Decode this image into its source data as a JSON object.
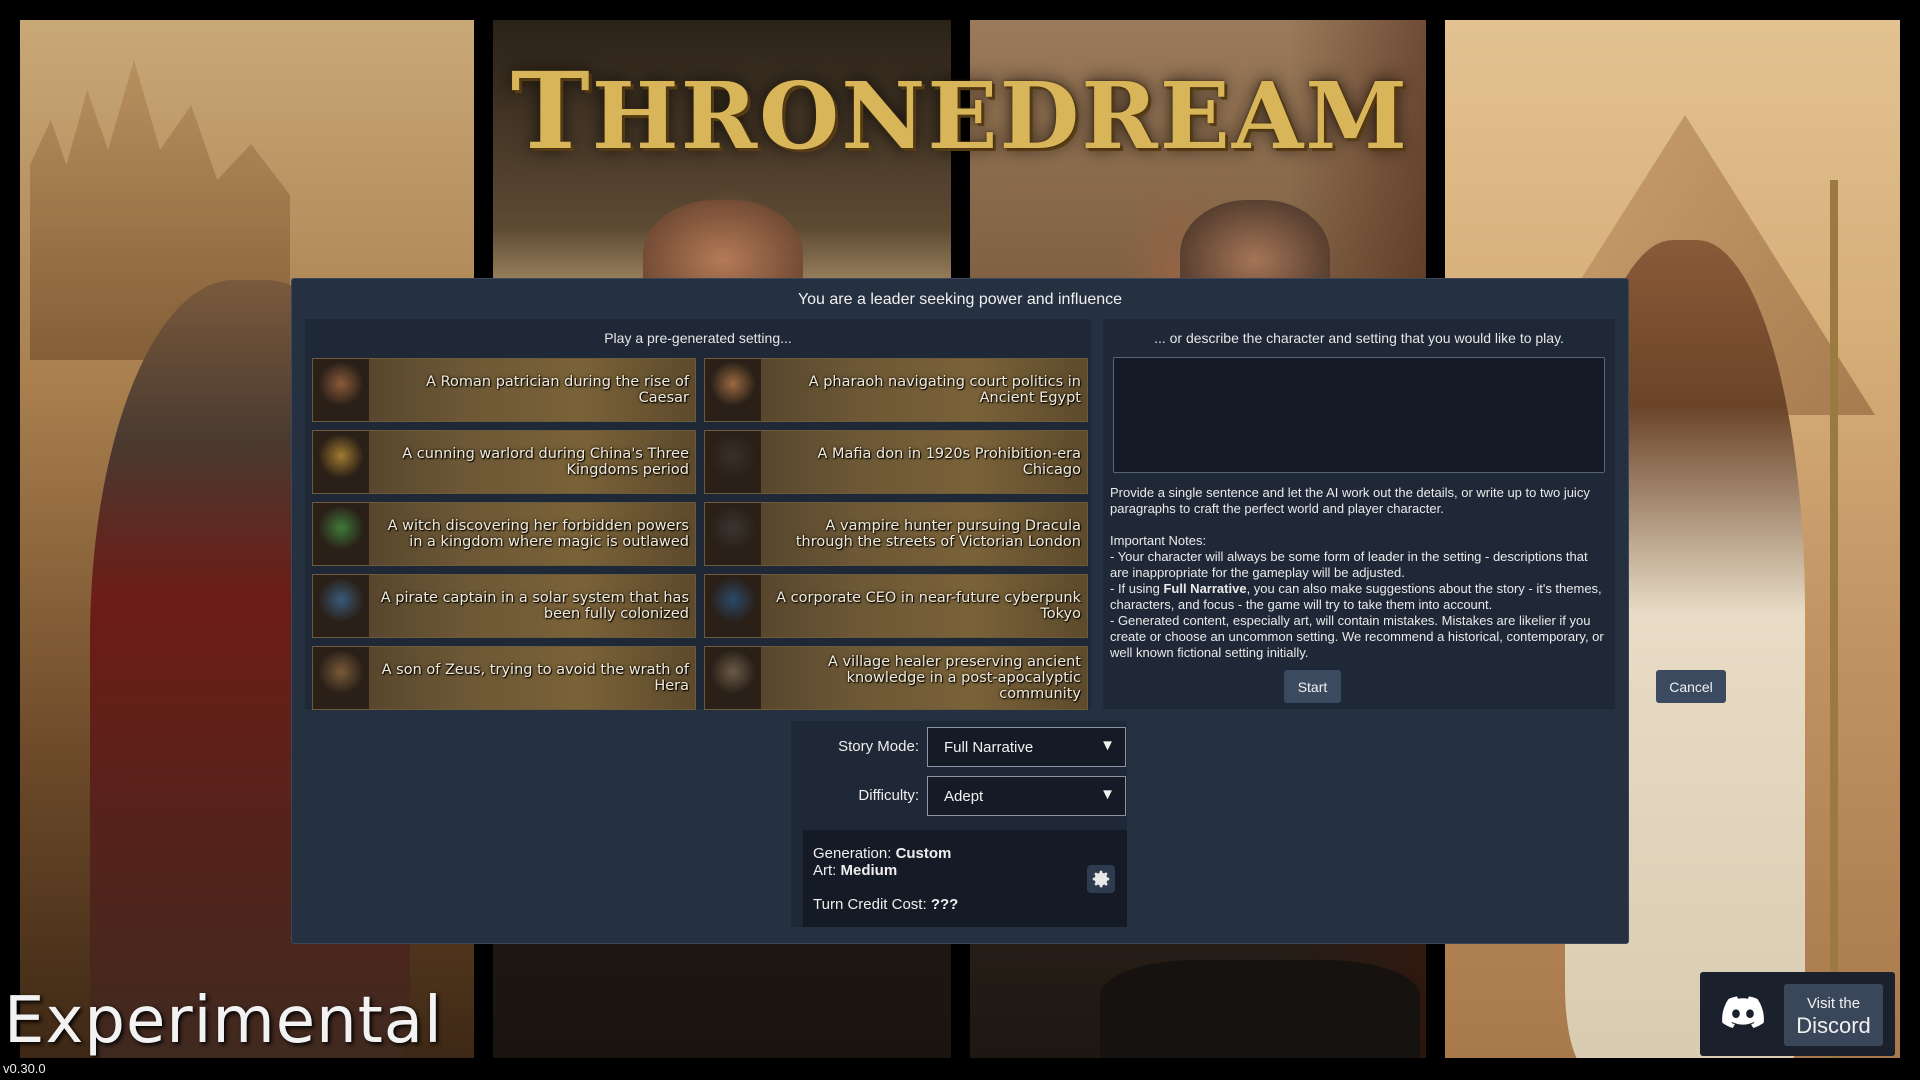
{
  "app": {
    "title": "Thronedream",
    "title_first_letter": "T",
    "title_rest": "HRONEDREAM",
    "experimental_label": "Experimental",
    "version": "v0.30.0"
  },
  "dialog": {
    "heading": "You are a leader seeking power and influence",
    "pregenerated_heading": "Play a pre-generated setting...",
    "settings": [
      {
        "label": "A Roman patrician during the rise of Caesar",
        "thumb_color": "#8a5a3a"
      },
      {
        "label": "A pharaoh navigating court politics in Ancient Egypt",
        "thumb_color": "#9a6a40"
      },
      {
        "label": "A cunning warlord during China's Three Kingdoms period",
        "thumb_color": "#a07a30"
      },
      {
        "label": "A Mafia don in 1920s Prohibition-era Chicago",
        "thumb_color": "#3a3028"
      },
      {
        "label": "A witch discovering her forbidden powers in a kingdom where magic is outlawed",
        "thumb_color": "#3f7a3a"
      },
      {
        "label": "A vampire hunter pursuing Dracula through the streets of Victorian London",
        "thumb_color": "#3a3530"
      },
      {
        "label": "A pirate captain in a solar system that has been fully colonized",
        "thumb_color": "#3a5a7a"
      },
      {
        "label": "A corporate CEO in near-future cyberpunk Tokyo",
        "thumb_color": "#2a4a6a"
      },
      {
        "label": "A son of Zeus, trying to avoid the wrath of Hera",
        "thumb_color": "#7a5a3a"
      },
      {
        "label": "A village healer preserving ancient knowledge in a post-apocalyptic community",
        "thumb_color": "#6a5a48"
      }
    ],
    "custom_heading": "... or describe the character and setting that you would like to play.",
    "custom_input_value": "",
    "help_intro": "Provide a single sentence and let the AI work out the details, or write up to two juicy paragraphs to craft the perfect world and player character.",
    "notes_heading": "Important Notes:",
    "note_1": "- Your character will always be some form of leader in the setting - descriptions that are inappropriate for the gameplay will be adjusted.",
    "note_2_prefix": "- If using ",
    "note_2_bold": "Full Narrative",
    "note_2_suffix": ", you can also make suggestions about the story - it's themes, characters, and focus - the game will try to take them into account.",
    "note_3": "- Generated content, especially art, will contain mistakes. Mistakes are likelier if you create or choose an uncommon setting. We recommend a historical, contemporary, or well known fictional setting initially.",
    "start_label": "Start",
    "cancel_label": "Cancel"
  },
  "options": {
    "story_mode_label": "Story Mode:",
    "story_mode_value": "Full Narrative",
    "difficulty_label": "Difficulty:",
    "difficulty_value": "Adept",
    "arrow_glyph": "▼",
    "generation_label": "Generation: ",
    "generation_value": "Custom",
    "art_label": "Art: ",
    "art_value": "Medium",
    "turn_cost_label": "Turn Credit Cost: ",
    "turn_cost_value": "???"
  },
  "discord": {
    "small_label": "Visit the",
    "big_label": "Discord"
  },
  "colors": {
    "dialog_bg": "#253041",
    "panel_bg": "#1f2836",
    "button_bg": "#3c4a60",
    "title_gold": "#d9b55a"
  }
}
